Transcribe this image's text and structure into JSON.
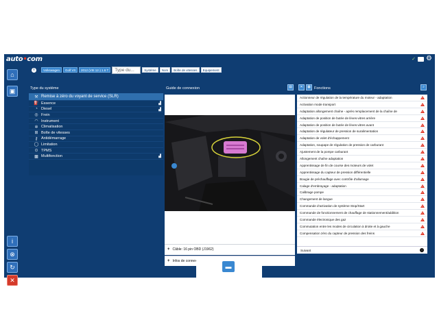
{
  "app": {
    "logo_main": "auto",
    "logo_dot": "•",
    "logo_end": "com"
  },
  "vehicle": {
    "chips": [
      "Volkswagen",
      "Golf VII",
      "2012 (VIII 12-) 1.6 T",
      ""
    ],
    "search_placeholder": "Type du...",
    "pills": [
      "Système",
      "Nom",
      "Boîte de vitesses",
      "Equipement"
    ]
  },
  "left": {
    "title": "Type du système",
    "systems": [
      {
        "label": "Remise à zéro du voyant de service (SLR)",
        "icon": "wrench-icon"
      },
      {
        "label": "Essence",
        "icon": "fuel-icon"
      },
      {
        "label": "Diesel",
        "icon": "diesel-icon"
      },
      {
        "label": "Frein",
        "icon": "brake-icon"
      },
      {
        "label": "Instrument",
        "icon": "gauge-icon"
      },
      {
        "label": "Climatisation",
        "icon": "fan-icon"
      },
      {
        "label": "Boîte de vitesses",
        "icon": "gearbox-icon"
      },
      {
        "label": "Antidémarrage",
        "icon": "key-icon"
      },
      {
        "label": "Limitation",
        "icon": "speed-limit-icon"
      },
      {
        "label": "TPMS",
        "icon": "tire-icon"
      },
      {
        "label": "Multifonction",
        "icon": "multifunction-icon"
      }
    ]
  },
  "middle": {
    "title": "Guide de connexion",
    "cable_label": "Câble: 16 pin OBD (J1962)",
    "info_label": "Infos de connexion"
  },
  "right": {
    "title": "Fonctions",
    "next_label": "Suivant",
    "functions": [
      "Actionneur de régulation de la température du moteur - adaptation",
      "Activation mode transport",
      "Adaptation allongement chaîne - après remplacement de la chaîne de",
      "Adaptation de position de butée de lèves-vitres arrière",
      "Adaptation de position de butée de lèves-vitres avant",
      "Adaptation de régulateur de pression de suralimentation",
      "Adaptation de volet d'échappement",
      "Adaptation, soupape de régulation de pression de carburant",
      "Ajustement de la pompe carburant",
      "Allongement chaîne adaptation",
      "Apprentissage de fin de course des moteurs de volet",
      "Apprentissage du capteur de pression différentielle",
      "Bougie de préchauffage avec contrôle d'allumage",
      "Calage d'embrayage - adaptation",
      "Calibrage pompe",
      "Changement de langue",
      "Commande d'activation de système Stop/Start",
      "Commande de fonctionnement de chauffage de stationnement/addition",
      "Commande électronique des gaz",
      "Commutation entre les modes de circulation à droite et à gauche",
      "Compensation zéro du capteur de pression des freins"
    ]
  },
  "colors": {
    "bg": "#0f3d72",
    "accent": "#3a88d1",
    "warning": "#e23a2a"
  }
}
